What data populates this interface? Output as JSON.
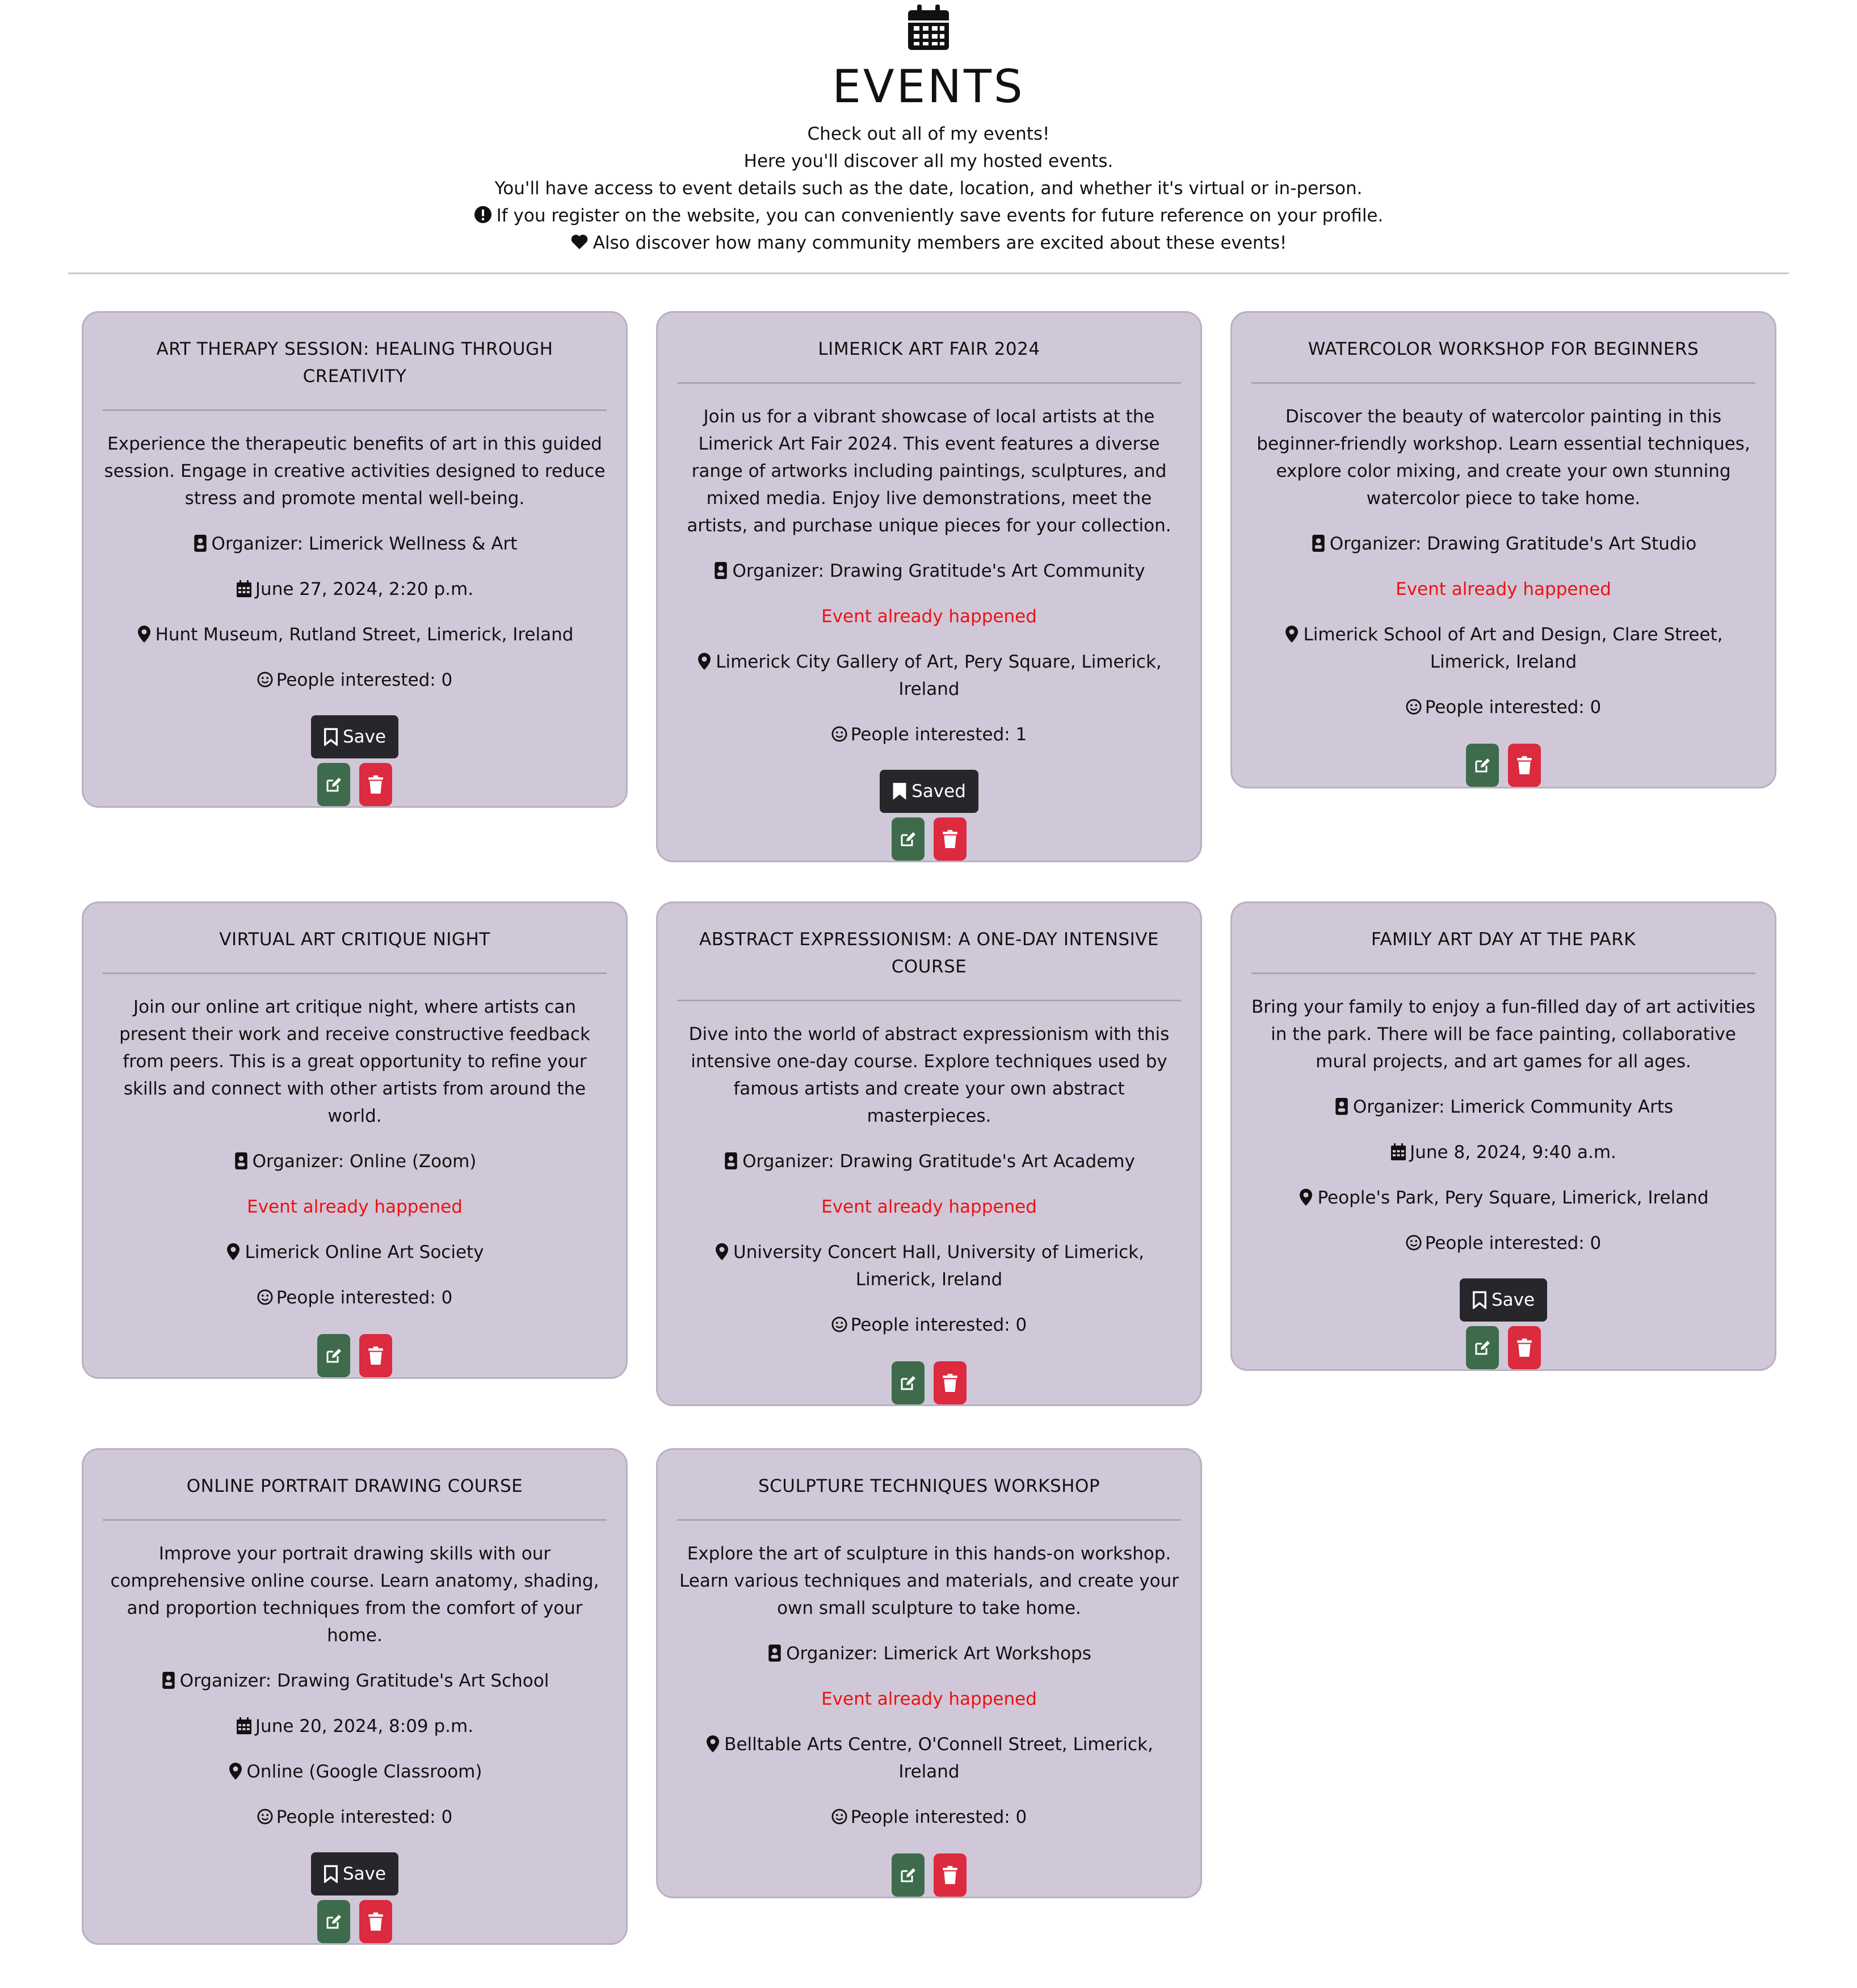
{
  "header": {
    "icon": "calendar-icon",
    "title": "EVENTS",
    "lines": [
      "Check out all of my events!",
      "Here you'll discover all my hosted events.",
      "You'll have access to event details such as the date, location, and whether it's virtual or in-person.",
      "If you register on the website, you can conveniently save events for future reference on your profile.",
      "Also discover how many community members are excited about these events!"
    ],
    "line4_icon": "exclamation-circle-icon",
    "line5_icon": "heart-icon"
  },
  "colors": {
    "card_bg": "#d0c8d8",
    "save_btn": "#26262b",
    "edit_btn": "#3d6b4c",
    "delete_btn": "#dc2a3e",
    "past_event": "#ee1111"
  },
  "events": [
    {
      "title": "ART THERAPY SESSION: HEALING THROUGH CREATIVITY",
      "description": "Experience the therapeutic benefits of art in this guided session. Engage in creative activities designed to reduce stress and promote mental well-being.",
      "organizer": "Organizer: Limerick Wellness & Art",
      "date": "June 27, 2024, 2:20 p.m.",
      "location": "Hunt Museum, Rutland Street, Limerick, Ireland",
      "interested": "People interested: 0",
      "save_label": "Save"
    },
    {
      "title": "LIMERICK ART FAIR 2024",
      "description": "Join us for a vibrant showcase of local artists at the Limerick Art Fair 2024. This event features a diverse range of artworks including paintings, sculptures, and mixed media. Enjoy live demonstrations, meet the artists, and purchase unique pieces for your collection.",
      "organizer": "Organizer: Drawing Gratitude's Art Community",
      "status": "Event already happened",
      "location": "Limerick City Gallery of Art, Pery Square, Limerick, Ireland",
      "interested": "People interested: 1",
      "save_label": "Saved"
    },
    {
      "title": "WATERCOLOR WORKSHOP FOR BEGINNERS",
      "description": "Discover the beauty of watercolor painting in this beginner-friendly workshop. Learn essential techniques, explore color mixing, and create your own stunning watercolor piece to take home.",
      "organizer": "Organizer: Drawing Gratitude's Art Studio",
      "status": "Event already happened",
      "location": "Limerick School of Art and Design, Clare Street, Limerick, Ireland",
      "interested": "People interested: 0"
    },
    {
      "title": "VIRTUAL ART CRITIQUE NIGHT",
      "description": "Join our online art critique night, where artists can present their work and receive constructive feedback from peers. This is a great opportunity to refine your skills and connect with other artists from around the world.",
      "organizer": "Organizer: Online (Zoom)",
      "status": "Event already happened",
      "location": "Limerick Online Art Society",
      "interested": "People interested: 0"
    },
    {
      "title": "ABSTRACT EXPRESSIONISM: A ONE-DAY INTENSIVE COURSE",
      "description": "Dive into the world of abstract expressionism with this intensive one-day course. Explore techniques used by famous artists and create your own abstract masterpieces.",
      "organizer": "Organizer: Drawing Gratitude's Art Academy",
      "status": "Event already happened",
      "location": "University Concert Hall, University of Limerick, Limerick, Ireland",
      "interested": "People interested: 0"
    },
    {
      "title": "FAMILY ART DAY AT THE PARK",
      "description": "Bring your family to enjoy a fun-filled day of art activities in the park. There will be face painting, collaborative mural projects, and art games for all ages.",
      "organizer": "Organizer: Limerick Community Arts",
      "date": "June 8, 2024, 9:40 a.m.",
      "location": "People's Park, Pery Square, Limerick, Ireland",
      "interested": "People interested: 0",
      "save_label": "Save"
    },
    {
      "title": "ONLINE PORTRAIT DRAWING COURSE",
      "description": "Improve your portrait drawing skills with our comprehensive online course. Learn anatomy, shading, and proportion techniques from the comfort of your home.",
      "organizer": "Organizer: Drawing Gratitude's Art School",
      "date": "June 20, 2024, 8:09 p.m.",
      "location": "Online (Google Classroom)",
      "interested": "People interested: 0",
      "save_label": "Save"
    },
    {
      "title": "SCULPTURE TECHNIQUES WORKSHOP",
      "description": "Explore the art of sculpture in this hands-on workshop. Learn various techniques and materials, and create your own small sculpture to take home.",
      "organizer": "Organizer: Limerick Art Workshops",
      "status": "Event already happened",
      "location": "Belltable Arts Centre, O'Connell Street, Limerick, Ireland",
      "interested": "People interested: 0"
    }
  ]
}
